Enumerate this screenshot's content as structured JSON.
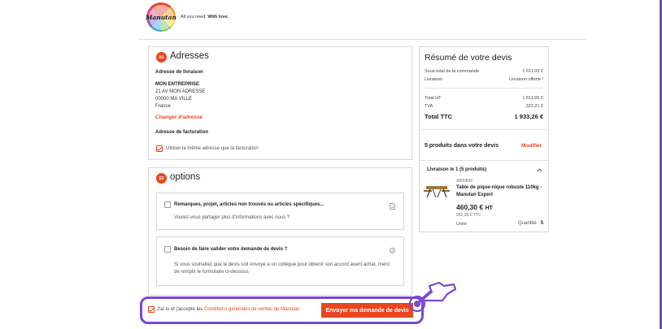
{
  "header": {
    "logo_text": "Manutan",
    "tagline_plain": "All you need.",
    "tagline_bold": "With love."
  },
  "addresses": {
    "step": "01",
    "title": "Adresses",
    "delivery_label": "Adresse de livraison",
    "company": "MON ENTREPRISE",
    "street": "21 AV MON ADRESSE",
    "city": "00000 MA VILLE",
    "country": "France",
    "change_link": "Changer d'adresse",
    "billing_label": "Adresse de facturation",
    "same_address_label": "Utiliser la même adresse que la facturation",
    "same_address_checked": true
  },
  "options": {
    "step": "02",
    "title": "options",
    "items": [
      {
        "title": "Remarques, projet, articles non trouvés ou articles spécifiques...",
        "description": "Voulez-vous partager plus d'informations avec nous ?",
        "icon": "document-icon"
      },
      {
        "title": "Besoin de faire valider votre demande de devis ?",
        "description_line1": "Si vous souhaitez que le devis soit envoyé à un collègue pour obtenir son accord avant achat, merci",
        "description_line2": "de remplir le formulaire ci-dessous",
        "icon": "check-circle-icon"
      }
    ]
  },
  "submit": {
    "terms_prefix": "J'ai lu et j'accepte les ",
    "terms_link": "Conditions générales de ventes de Manutan",
    "terms_checked": true,
    "button_label": "Envoyer ma demande de devis"
  },
  "summary": {
    "title": "Résumé de votre devis",
    "subtotal_label": "Sous-total de la commande",
    "subtotal_value": "1 611,05 €",
    "shipping_label": "Livraison",
    "shipping_value": "Livraison offerte !",
    "total_ht_label": "Total HT",
    "total_ht_value": "1 611,05 €",
    "tva_label": "TVA",
    "tva_value": "322,21 €",
    "total_ttc_label": "Total TTC",
    "total_ttc_value": "1 933,26 €"
  },
  "products": {
    "title": "5 produits dans votre devis",
    "edit_link": "Modifier",
    "delivery_group": "Livraison le 1 (5 produits)",
    "item": {
      "ref": "A890845",
      "name_line1": "Table de pique-nique robuste 110kg -",
      "name_line2": "Manutan Expert",
      "price_ht_amount": "460,30 €",
      "price_ht_suffix": "HT",
      "price_ttc": "552,36 € TTC",
      "unit": "Unité",
      "quantity_label": "Quantité :",
      "quantity_value": "5"
    }
  },
  "colors": {
    "accent": "#e8461e",
    "highlight": "#7a46d6"
  }
}
